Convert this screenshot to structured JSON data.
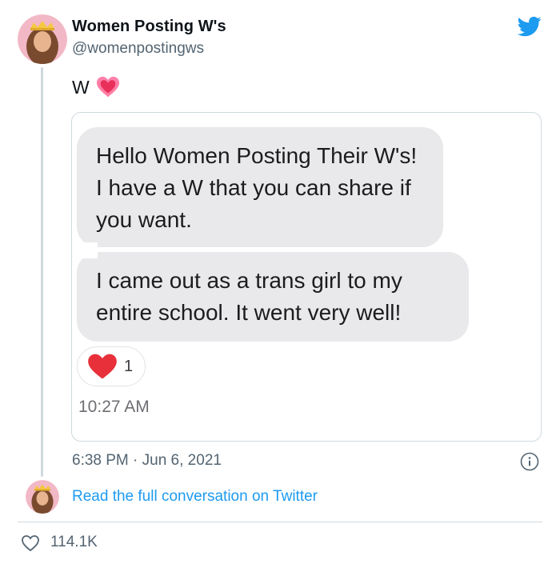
{
  "author": {
    "name": "Women Posting W's",
    "handle": "@womenpostingws"
  },
  "tweet": {
    "text": "W",
    "emoji": "heart-emoji",
    "timestamp": "6:38 PM · Jun 6, 2021",
    "read_more": "Read the full conversation on Twitter",
    "likes": "114.1K"
  },
  "embedded_messages": {
    "bubbles": [
      "Hello Women Posting Their W's! I have a W that you can share if you want.",
      "I came out as a trans girl to my entire school. It went very well!"
    ],
    "reaction_count": "1",
    "time": "10:27 AM"
  },
  "colors": {
    "link": "#1d9bf0",
    "twitter_bird": "#1d9bf0",
    "bubble": "#e9e9eb",
    "reaction_heart": "#e8303a"
  },
  "icons": [
    "twitter-bird-icon",
    "info-icon",
    "heart-outline-icon",
    "pink-heart-emoji",
    "red-heart-reaction-icon"
  ]
}
